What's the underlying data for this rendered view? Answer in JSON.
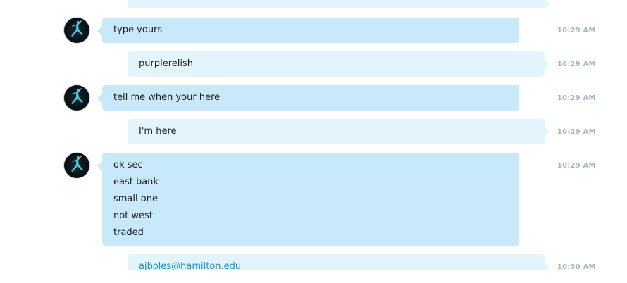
{
  "conversation": {
    "messages": [
      {
        "direction": "in",
        "lines": [
          "type yours"
        ],
        "time": "10:29 AM"
      },
      {
        "direction": "out",
        "lines": [
          "purplerelish"
        ],
        "time": "10:29 AM"
      },
      {
        "direction": "in",
        "lines": [
          "tell me when your here"
        ],
        "time": "10:29 AM"
      },
      {
        "direction": "out",
        "lines": [
          "I'm here"
        ],
        "time": "10:29 AM"
      },
      {
        "direction": "in",
        "lines": [
          "ok sec",
          "east bank",
          "small one",
          "not west",
          "traded"
        ],
        "time": "10:29 AM"
      },
      {
        "direction": "out",
        "lines": [
          "ajboles@hamilton.edu"
        ],
        "time": "10:30 AM",
        "link": true
      }
    ]
  },
  "avatar": {
    "icon": "jumpman-logo-icon",
    "accent": "#4fc3d9"
  },
  "colors": {
    "incoming_bubble": "#c7e9f9",
    "outgoing_bubble": "#e3f4fc",
    "timestamp": "#a3b5c0",
    "link": "#1a8fc2"
  }
}
